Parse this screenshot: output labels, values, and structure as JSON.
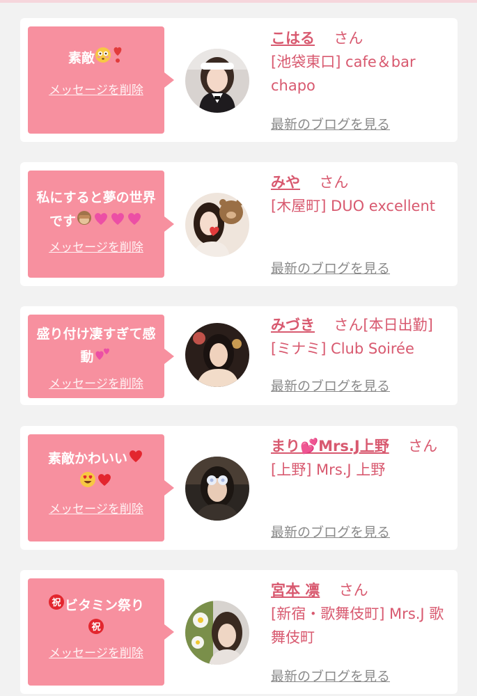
{
  "delete_label": "メッセージを削除",
  "blog_label": "最新のブログを見る",
  "cards": [
    {
      "message": "素敵",
      "name": "こはる",
      "suffix": "さん",
      "shop": "[池袋東口] cafe＆bar chapo"
    },
    {
      "message": "私にすると夢の世界です",
      "name": "みや",
      "suffix": "さん",
      "shop": "[木屋町] DUO excellent"
    },
    {
      "message": "盛り付け凄すぎて感動",
      "name": "みづき",
      "suffix": "さん[本日出勤]",
      "shop": "[ミナミ] Club Soirée"
    },
    {
      "message": "素敵かわいい",
      "name": "まり💕Mrs.J上野",
      "suffix": "さん",
      "shop": "[上野] Mrs.J 上野"
    },
    {
      "message": "ビタミン祭り",
      "name": "宮本 凛",
      "suffix": "さん",
      "shop": "[新宿・歌舞伎町] Mrs.J 歌舞伎町"
    }
  ],
  "colors": {
    "bubble": "#f7909f",
    "accent": "#d8596f",
    "link_gray": "#8a8a8a",
    "background": "#f2f2f2"
  },
  "icons": [
    "flushed-face-icon",
    "exclamation-heart-icon",
    "see-no-evil-monkey-icon",
    "growing-heart-icon",
    "two-hearts-icon",
    "red-heart-icon",
    "heart-eyes-icon",
    "congratulation-icon"
  ]
}
